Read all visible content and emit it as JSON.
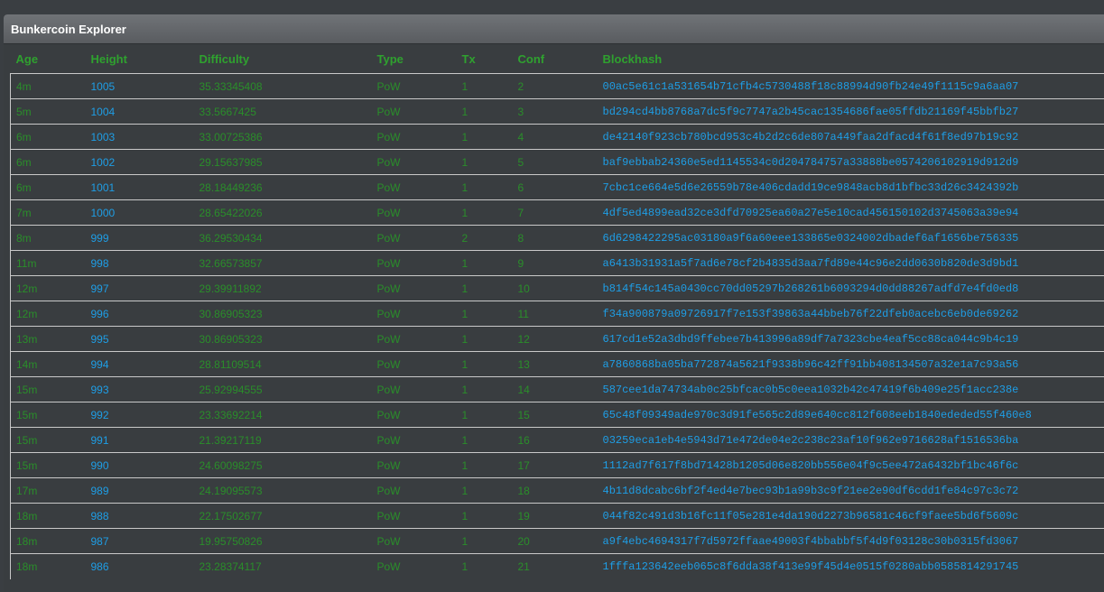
{
  "panel": {
    "title": "Bunkercoin Explorer"
  },
  "table": {
    "headers": [
      "Age",
      "Height",
      "Difficulty",
      "Type",
      "Tx",
      "Conf",
      "Blockhash"
    ],
    "rows": [
      {
        "age": "4m",
        "height": "1005",
        "difficulty": "35.33345408",
        "type": "PoW",
        "tx": "1",
        "conf": "2",
        "hash": "00ac5e61c1a531654b71cfb4c5730488f18c88994d90fb24e49f1115c9a6aa07"
      },
      {
        "age": "5m",
        "height": "1004",
        "difficulty": "33.5667425",
        "type": "PoW",
        "tx": "1",
        "conf": "3",
        "hash": "bd294cd4bb8768a7dc5f9c7747a2b45cac1354686fae05ffdb21169f45bbfb27"
      },
      {
        "age": "6m",
        "height": "1003",
        "difficulty": "33.00725386",
        "type": "PoW",
        "tx": "1",
        "conf": "4",
        "hash": "de42140f923cb780bcd953c4b2d2c6de807a449faa2dfacd4f61f8ed97b19c92"
      },
      {
        "age": "6m",
        "height": "1002",
        "difficulty": "29.15637985",
        "type": "PoW",
        "tx": "1",
        "conf": "5",
        "hash": "baf9ebbab24360e5ed1145534c0d204784757a33888be0574206102919d912d9"
      },
      {
        "age": "6m",
        "height": "1001",
        "difficulty": "28.18449236",
        "type": "PoW",
        "tx": "1",
        "conf": "6",
        "hash": "7cbc1ce664e5d6e26559b78e406cdadd19ce9848acb8d1bfbc33d26c3424392b"
      },
      {
        "age": "7m",
        "height": "1000",
        "difficulty": "28.65422026",
        "type": "PoW",
        "tx": "1",
        "conf": "7",
        "hash": "4df5ed4899ead32ce3dfd70925ea60a27e5e10cad456150102d3745063a39e94"
      },
      {
        "age": "8m",
        "height": "999",
        "difficulty": "36.29530434",
        "type": "PoW",
        "tx": "2",
        "conf": "8",
        "hash": "6d6298422295ac03180a9f6a60eee133865e0324002dbadef6af1656be756335"
      },
      {
        "age": "11m",
        "height": "998",
        "difficulty": "32.66573857",
        "type": "PoW",
        "tx": "1",
        "conf": "9",
        "hash": "a6413b31931a5f7ad6e78cf2b4835d3aa7fd89e44c96e2dd0630b820de3d9bd1"
      },
      {
        "age": "12m",
        "height": "997",
        "difficulty": "29.39911892",
        "type": "PoW",
        "tx": "1",
        "conf": "10",
        "hash": "b814f54c145a0430cc70dd05297b268261b6093294d0dd88267adfd7e4fd0ed8"
      },
      {
        "age": "12m",
        "height": "996",
        "difficulty": "30.86905323",
        "type": "PoW",
        "tx": "1",
        "conf": "11",
        "hash": "f34a900879a09726917f7e153f39863a44bbeb76f22dfeb0acebc6eb0de69262"
      },
      {
        "age": "13m",
        "height": "995",
        "difficulty": "30.86905323",
        "type": "PoW",
        "tx": "1",
        "conf": "12",
        "hash": "617cd1e52a3dbd9ffebee7b413996a89df7a7323cbe4eaf5cc88ca044c9b4c19"
      },
      {
        "age": "14m",
        "height": "994",
        "difficulty": "28.81109514",
        "type": "PoW",
        "tx": "1",
        "conf": "13",
        "hash": "a7860868ba05ba772874a5621f9338b96c42ff91bb408134507a32e1a7c93a56"
      },
      {
        "age": "15m",
        "height": "993",
        "difficulty": "25.92994555",
        "type": "PoW",
        "tx": "1",
        "conf": "14",
        "hash": "587cee1da74734ab0c25bfcac0b5c0eea1032b42c47419f6b409e25f1acc238e"
      },
      {
        "age": "15m",
        "height": "992",
        "difficulty": "23.33692214",
        "type": "PoW",
        "tx": "1",
        "conf": "15",
        "hash": "65c48f09349ade970c3d91fe565c2d89e640cc812f608eeb1840ededed55f460e8"
      },
      {
        "age": "15m",
        "height": "991",
        "difficulty": "21.39217119",
        "type": "PoW",
        "tx": "1",
        "conf": "16",
        "hash": "03259eca1eb4e5943d71e472de04e2c238c23af10f962e9716628af1516536ba"
      },
      {
        "age": "15m",
        "height": "990",
        "difficulty": "24.60098275",
        "type": "PoW",
        "tx": "1",
        "conf": "17",
        "hash": "1112ad7f617f8bd71428b1205d06e820bb556e04f9c5ee472a6432bf1bc46f6c"
      },
      {
        "age": "17m",
        "height": "989",
        "difficulty": "24.19095573",
        "type": "PoW",
        "tx": "1",
        "conf": "18",
        "hash": "4b11d8dcabc6bf2f4ed4e7bec93b1a99b3c9f21ee2e90df6cdd1fe84c97c3c72"
      },
      {
        "age": "18m",
        "height": "988",
        "difficulty": "22.17502677",
        "type": "PoW",
        "tx": "1",
        "conf": "19",
        "hash": "044f82c491d3b16fc11f05e281e4da190d2273b96581c46cf9faee5bd6f5609c"
      },
      {
        "age": "18m",
        "height": "987",
        "difficulty": "19.95750826",
        "type": "PoW",
        "tx": "1",
        "conf": "20",
        "hash": "a9f4ebc4694317f7d5972ffaae49003f4bbabbf5f4d9f03128c30b0315fd3067"
      },
      {
        "age": "18m",
        "height": "986",
        "difficulty": "23.28374117",
        "type": "PoW",
        "tx": "1",
        "conf": "21",
        "hash": "1fffa123642eeb065c8f6dda38f413e99f45d4e0515f0280abb0585814291745"
      }
    ]
  }
}
